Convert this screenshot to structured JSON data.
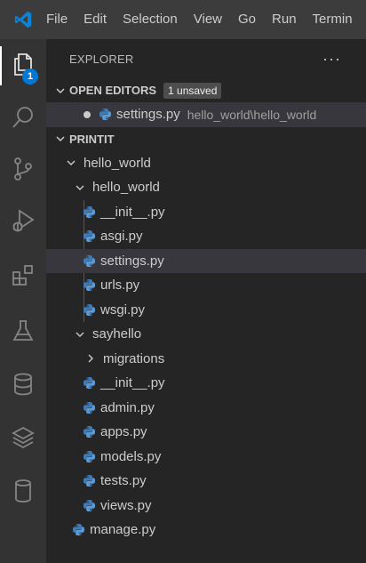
{
  "menubar": {
    "items": [
      "File",
      "Edit",
      "Selection",
      "View",
      "Go",
      "Run",
      "Termin"
    ]
  },
  "activity": {
    "explorer_badge": "1",
    "icons": [
      "files-icon",
      "search-icon",
      "source-control-icon",
      "run-debug-icon",
      "extensions-icon",
      "testing-icon",
      "database-icon",
      "layers-icon",
      "cylinder-icon"
    ]
  },
  "sidebar": {
    "title": "EXPLORER",
    "more": "···",
    "open_editors": {
      "label": "OPEN EDITORS",
      "badge": "1 unsaved",
      "files": [
        {
          "name": "settings.py",
          "path": "hello_world\\hello_world"
        }
      ]
    },
    "project": {
      "label": "PRINTIT",
      "tree": [
        {
          "name": "hello_world",
          "type": "folder",
          "expanded": true
        },
        {
          "name": "hello_world",
          "type": "folder",
          "expanded": true
        },
        {
          "name": "__init__.py",
          "type": "python"
        },
        {
          "name": "asgi.py",
          "type": "python"
        },
        {
          "name": "settings.py",
          "type": "python",
          "selected": true
        },
        {
          "name": "urls.py",
          "type": "python"
        },
        {
          "name": "wsgi.py",
          "type": "python"
        },
        {
          "name": "sayhello",
          "type": "folder",
          "expanded": true
        },
        {
          "name": "migrations",
          "type": "folder",
          "expanded": false
        },
        {
          "name": "__init__.py",
          "type": "python"
        },
        {
          "name": "admin.py",
          "type": "python"
        },
        {
          "name": "apps.py",
          "type": "python"
        },
        {
          "name": "models.py",
          "type": "python"
        },
        {
          "name": "tests.py",
          "type": "python"
        },
        {
          "name": "views.py",
          "type": "python"
        },
        {
          "name": "manage.py",
          "type": "python"
        }
      ]
    }
  },
  "colors": {
    "menubar": "#3c3c3c",
    "activitybar": "#333333",
    "sidebar": "#252526",
    "selection": "#37373d",
    "badge": "#0078d4",
    "python_blue": "#4b8bbe",
    "python_yellow": "#ffd43b",
    "vscode_blue": "#0a84d8"
  }
}
